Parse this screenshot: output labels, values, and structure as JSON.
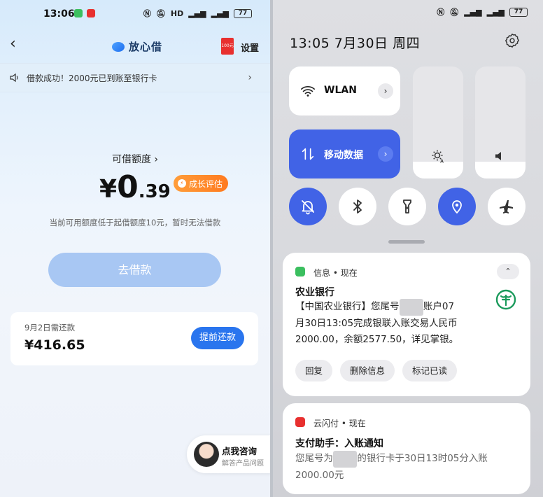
{
  "left": {
    "status_bar": {
      "time": "13:06",
      "battery": "77"
    },
    "nav": {
      "back": "‹",
      "brand": "放心借",
      "settings": "设置",
      "coupon": "100元"
    },
    "notice": {
      "text": "借款成功！2000元已到账至银行卡",
      "arrow": "›"
    },
    "credit": {
      "label": "可借额度",
      "label_arrow": "›",
      "currency": "¥",
      "amount_int": "0",
      "amount_dec": ".39",
      "grow_button": "成长评估",
      "hint": "当前可用额度低于起借额度10元，暂时无法借款",
      "borrow_button": "去借款"
    },
    "repay": {
      "due_label": "9月2日需还款",
      "amount": "¥416.65",
      "button": "提前还款"
    },
    "consult": {
      "title": "点我咨询",
      "subtitle": "解答产品问题"
    }
  },
  "right": {
    "status_bar": {
      "battery": "77"
    },
    "qs_header": {
      "time_date": "13:05  7月30日 周四"
    },
    "tiles": {
      "wlan": {
        "label": "WLAN",
        "arrow": "›"
      },
      "mobile_data": {
        "label": "移动数据",
        "arrow": "›"
      }
    },
    "sliders": {
      "brightness_level": 0.15,
      "volume_level": 0.15
    },
    "toggles": [
      {
        "name": "mute",
        "on": true
      },
      {
        "name": "bluetooth",
        "on": false
      },
      {
        "name": "flashlight",
        "on": false
      },
      {
        "name": "location",
        "on": true
      },
      {
        "name": "airplane",
        "on": false
      }
    ],
    "notif1": {
      "source": "信息 • 现在",
      "collapse": "⌃",
      "title": "农业银行",
      "line1_a": "【中国农业银行】您尾号",
      "line1_masked": "0000",
      "line1_b": "账户07",
      "line2": "月30日13:05完成银联入账交易人民币",
      "line3": "2000.00，余额2577.50，详见掌银。",
      "actions": [
        "回复",
        "删除信息",
        "标记已读"
      ]
    },
    "notif2": {
      "source": "云闪付 • 现在",
      "title": "支付助手：入账通知",
      "line1_a": "您尾号为",
      "line1_masked": "0000",
      "line1_b": "的银行卡于30日13时05分入账",
      "line2": "2000.00元"
    },
    "colors": {
      "accent_blue": "#4163e6",
      "abc_green": "#1a9a5b",
      "messages_green": "#3bbf5f",
      "unionpay_red": "#e8302f"
    }
  }
}
